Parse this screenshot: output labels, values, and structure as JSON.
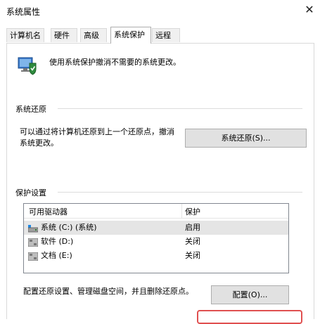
{
  "window": {
    "title": "系统属性",
    "close_glyph": "✕"
  },
  "tabs": [
    {
      "label": "计算机名"
    },
    {
      "label": "硬件"
    },
    {
      "label": "高级"
    },
    {
      "label": "系统保护",
      "active": true
    },
    {
      "label": "远程"
    }
  ],
  "intro": {
    "text": "使用系统保护撤消不需要的系统更改。",
    "icon": "monitor-shield-icon"
  },
  "system_restore": {
    "heading": "系统还原",
    "description": "可以通过将计算机还原到上一个还原点，撤消系统更改。",
    "button_label": "系统还原(S)..."
  },
  "protection": {
    "heading": "保护设置",
    "columns": [
      "可用驱动器",
      "保护"
    ],
    "drives": [
      {
        "name": "系统 (C:) (系统)",
        "status": "启用",
        "icon": "system-drive-icon",
        "selected": true
      },
      {
        "name": "软件 (D:)",
        "status": "关闭",
        "icon": "drive-icon"
      },
      {
        "name": "文档 (E:)",
        "status": "关闭",
        "icon": "drive-icon"
      }
    ],
    "configure_text": "配置还原设置、管理磁盘空间，并且删除还原点。",
    "configure_button_label": "配置(O)..."
  },
  "colors": {
    "highlight_box": "#e05050",
    "selected_row": "#e5e5e5",
    "button_bg": "#e1e1e1"
  }
}
